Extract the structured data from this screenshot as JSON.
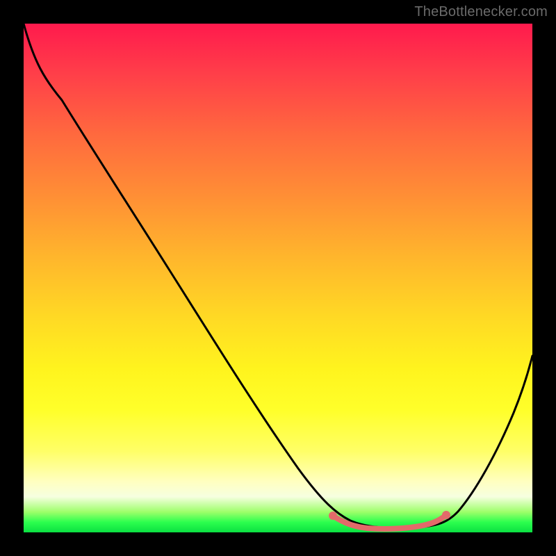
{
  "watermark": "TheBottlenecker.com",
  "colors": {
    "background": "#000000",
    "curve": "#000000",
    "highlight": "#e26a6a",
    "watermark_text": "#6b6b6b"
  },
  "chart_data": {
    "type": "line",
    "title": "",
    "xlabel": "",
    "ylabel": "",
    "xlim": [
      0,
      100
    ],
    "ylim": [
      0,
      100
    ],
    "grid": false,
    "legend": false,
    "series": [
      {
        "name": "bottleneck_curve",
        "x": [
          0,
          5,
          10,
          15,
          20,
          25,
          30,
          35,
          40,
          45,
          50,
          55,
          60,
          62,
          65,
          68,
          70,
          73,
          76,
          79,
          82,
          85,
          88,
          91,
          94,
          97,
          100
        ],
        "y": [
          100,
          96,
          90,
          82,
          75,
          67,
          59,
          51,
          43,
          35,
          27,
          19,
          11,
          8,
          5,
          3,
          2,
          1,
          1,
          1,
          2,
          4,
          8,
          14,
          22,
          31,
          41
        ]
      }
    ],
    "annotations": [
      {
        "name": "near_zero_band",
        "x_range": [
          60,
          82
        ],
        "color": "#e26a6a"
      }
    ]
  }
}
